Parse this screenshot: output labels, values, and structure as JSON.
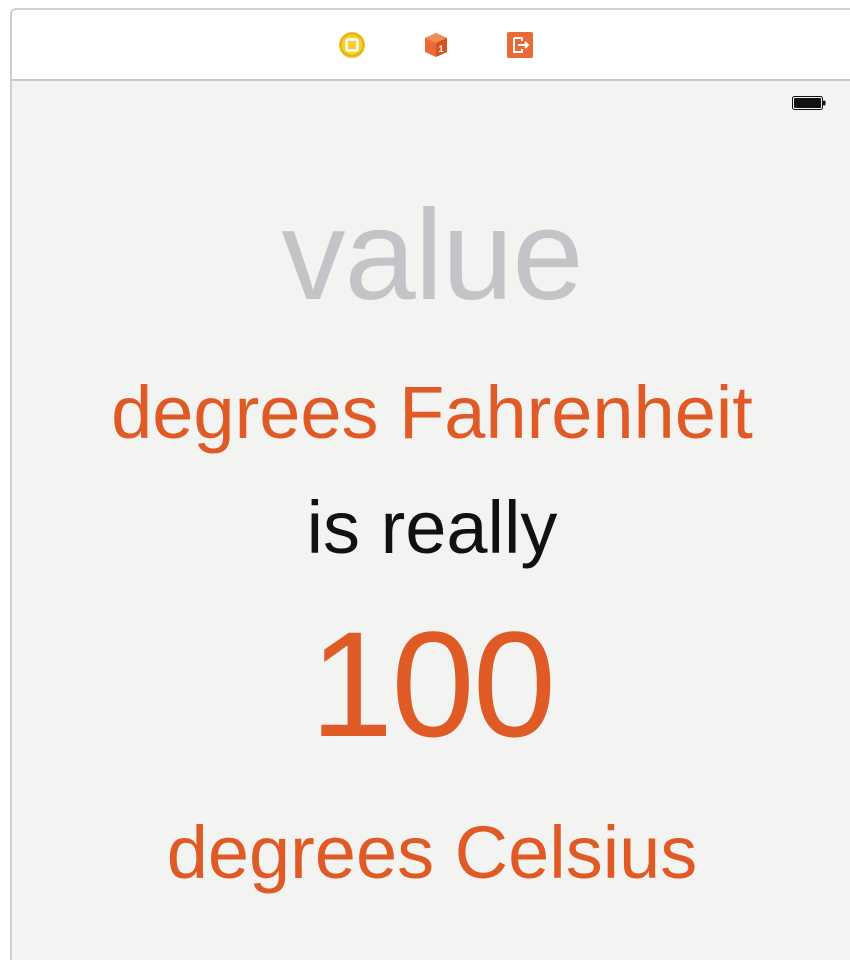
{
  "scene_dock": {
    "icons": [
      "view-controller-icon",
      "first-responder-icon",
      "exit-icon"
    ]
  },
  "status_bar": {
    "battery_icon": "battery-icon"
  },
  "content": {
    "value_placeholder": "value",
    "fahrenheit_label": "degrees Fahrenheit",
    "connector_label": "is really",
    "celsius_value": "100",
    "celsius_label": "degrees Celsius"
  },
  "colors": {
    "accent": "#e05a26",
    "placeholder": "#c3c3c8",
    "text": "#111111",
    "background": "#f3f3f1",
    "dock_yellow": "#f2c21b"
  }
}
